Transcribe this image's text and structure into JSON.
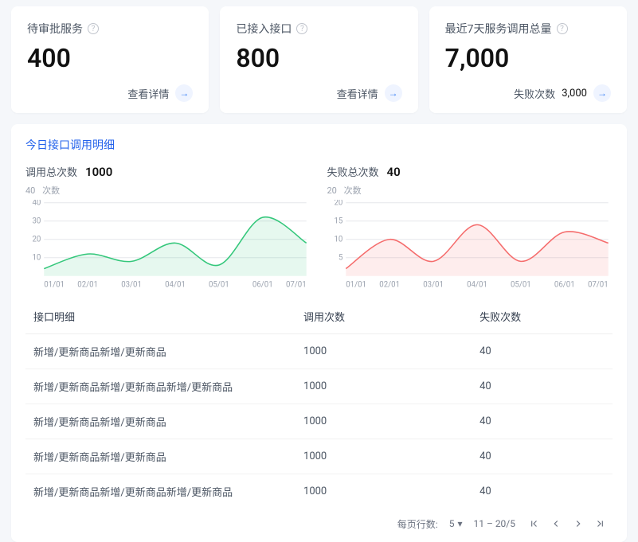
{
  "cards": [
    {
      "title": "待审批服务",
      "value": "400",
      "link_label": "查看详情"
    },
    {
      "title": "已接入接口",
      "value": "800",
      "link_label": "查看详情"
    },
    {
      "title": "最近7天服务调用总量",
      "value": "7,000",
      "fail_label": "失败次数",
      "fail_value": "3,000"
    }
  ],
  "panel_title": "今日接口调用明细",
  "chart1": {
    "label": "调用总次数",
    "value": "1000",
    "unit": "次数",
    "ymax": "40",
    "color": "#34c77b"
  },
  "chart2": {
    "label": "失败总次数",
    "value": "40",
    "unit": "次数",
    "ymax": "20",
    "color": "#f56c6c"
  },
  "chart_data": [
    {
      "type": "area",
      "title": "调用总次数",
      "x": [
        "01/01",
        "02/01",
        "03/01",
        "04/01",
        "05/01",
        "06/01",
        "07/01"
      ],
      "y": [
        4,
        12,
        8,
        18,
        6,
        32,
        18
      ],
      "ylabel": "次数",
      "ylim": [
        0,
        40
      ],
      "yticks": [
        10,
        20,
        30,
        40
      ],
      "color": "#34c77b"
    },
    {
      "type": "area",
      "title": "失败总次数",
      "x": [
        "01/01",
        "02/01",
        "03/01",
        "04/01",
        "05/01",
        "06/01",
        "07/01"
      ],
      "y": [
        2,
        10,
        4,
        14,
        4,
        12,
        9
      ],
      "ylabel": "次数",
      "ylim": [
        0,
        20
      ],
      "yticks": [
        5,
        10,
        15,
        20
      ],
      "color": "#f56c6c"
    }
  ],
  "table": {
    "columns": [
      "接口明细",
      "调用次数",
      "失败次数"
    ],
    "rows": [
      [
        "新增/更新商品新增/更新商品",
        "1000",
        "40"
      ],
      [
        "新增/更新商品新增/更新商品新增/更新商品",
        "1000",
        "40"
      ],
      [
        "新增/更新商品新增/更新商品",
        "1000",
        "40"
      ],
      [
        "新增/更新商品新增/更新商品",
        "1000",
        "40"
      ],
      [
        "新增/更新商品新增/更新商品新增/更新商品",
        "1000",
        "40"
      ]
    ]
  },
  "pagination": {
    "rows_label": "每页行数:",
    "page_size": "5",
    "range": "11 – 20/5"
  }
}
